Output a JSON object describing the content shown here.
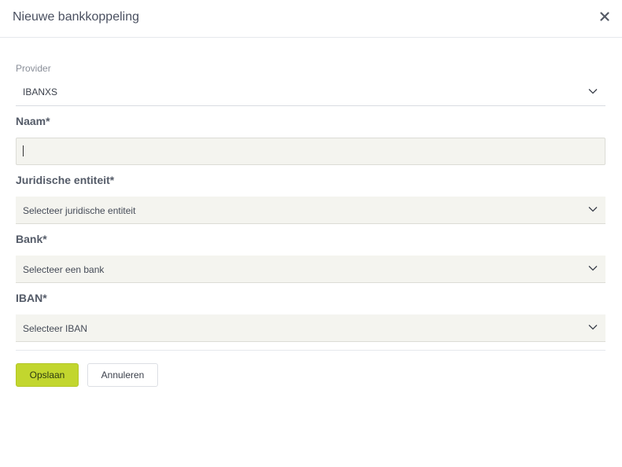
{
  "modal": {
    "title": "Nieuwe bankkoppeling",
    "close_icon": "close-icon"
  },
  "form": {
    "provider": {
      "label": "Provider",
      "value": "IBANXS"
    },
    "name": {
      "label": "Naam*",
      "value": "",
      "placeholder": ""
    },
    "legal_entity": {
      "label": "Juridische entiteit*",
      "placeholder": "Selecteer juridische entiteit"
    },
    "bank": {
      "label": "Bank*",
      "placeholder": "Selecteer een bank"
    },
    "iban": {
      "label": "IBAN*",
      "placeholder": "Selecteer IBAN"
    }
  },
  "actions": {
    "save_label": "Opslaan",
    "cancel_label": "Annuleren"
  },
  "colors": {
    "primary_button": "#c2d62e",
    "input_background": "#f4f4ef"
  }
}
